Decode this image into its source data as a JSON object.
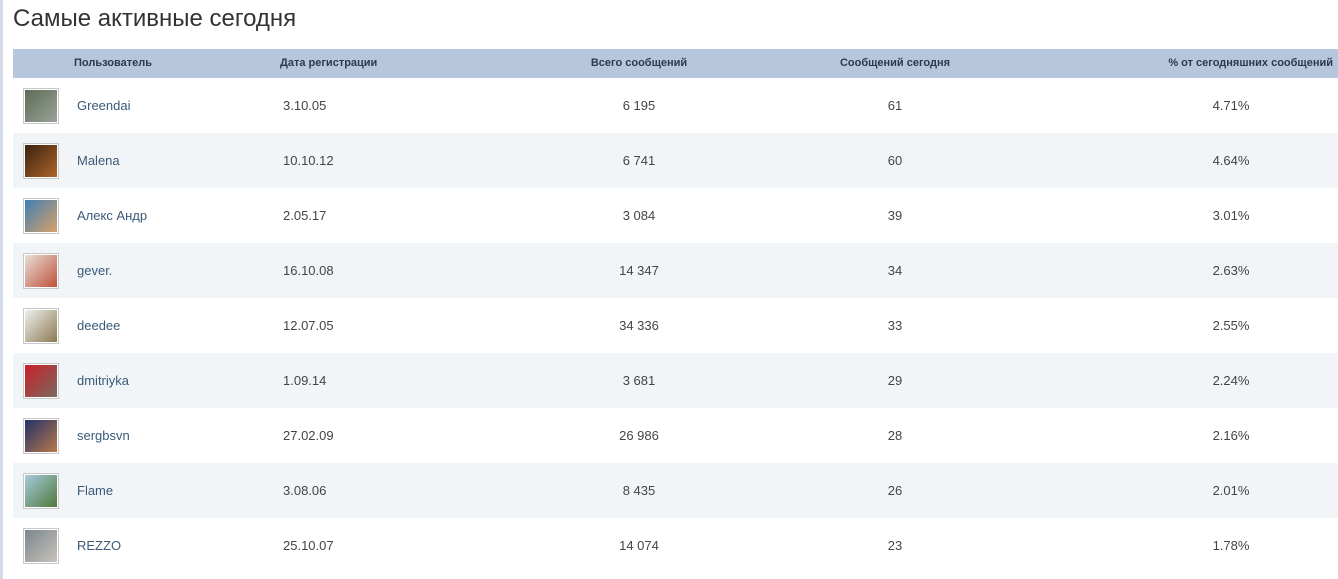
{
  "page": {
    "title": "Самые активные сегодня"
  },
  "table": {
    "headers": {
      "user": "Пользователь",
      "registered": "Дата регистрации",
      "total_posts": "Всего сообщений",
      "posts_today": "Сообщений сегодня",
      "percent_today": "% от сегодняшних сообщений"
    },
    "rows": [
      {
        "user": "Greendai",
        "registered": "3.10.05",
        "total_posts": "6 195",
        "posts_today": "61",
        "percent_today": "4.71%",
        "avatar_colors": [
          "#5d6b55",
          "#9aa49a"
        ]
      },
      {
        "user": "Malena",
        "registered": "10.10.12",
        "total_posts": "6 741",
        "posts_today": "60",
        "percent_today": "4.64%",
        "avatar_colors": [
          "#3a2210",
          "#b0642a"
        ]
      },
      {
        "user": "Алекс Андр",
        "registered": "2.05.17",
        "total_posts": "3 084",
        "posts_today": "39",
        "percent_today": "3.01%",
        "avatar_colors": [
          "#3f7fb3",
          "#d8a06a"
        ]
      },
      {
        "user": "gever.",
        "registered": "16.10.08",
        "total_posts": "14 347",
        "posts_today": "34",
        "percent_today": "2.63%",
        "avatar_colors": [
          "#e8e0d6",
          "#c0503a"
        ]
      },
      {
        "user": "deedee",
        "registered": "12.07.05",
        "total_posts": "34 336",
        "posts_today": "33",
        "percent_today": "2.55%",
        "avatar_colors": [
          "#eef0ef",
          "#8c7a52"
        ]
      },
      {
        "user": "dmitriyka",
        "registered": "1.09.14",
        "total_posts": "3 681",
        "posts_today": "29",
        "percent_today": "2.24%",
        "avatar_colors": [
          "#c8202a",
          "#7a6a5e"
        ]
      },
      {
        "user": "sergbsvn",
        "registered": "27.02.09",
        "total_posts": "26 986",
        "posts_today": "28",
        "percent_today": "2.16%",
        "avatar_colors": [
          "#24306a",
          "#b87a4a"
        ]
      },
      {
        "user": "Flame",
        "registered": "3.08.06",
        "total_posts": "8 435",
        "posts_today": "26",
        "percent_today": "2.01%",
        "avatar_colors": [
          "#a7c9de",
          "#4f7a3a"
        ]
      },
      {
        "user": "REZZO",
        "registered": "25.10.07",
        "total_posts": "14 074",
        "posts_today": "23",
        "percent_today": "1.78%",
        "avatar_colors": [
          "#7b8790",
          "#c8c2b8"
        ]
      }
    ]
  }
}
